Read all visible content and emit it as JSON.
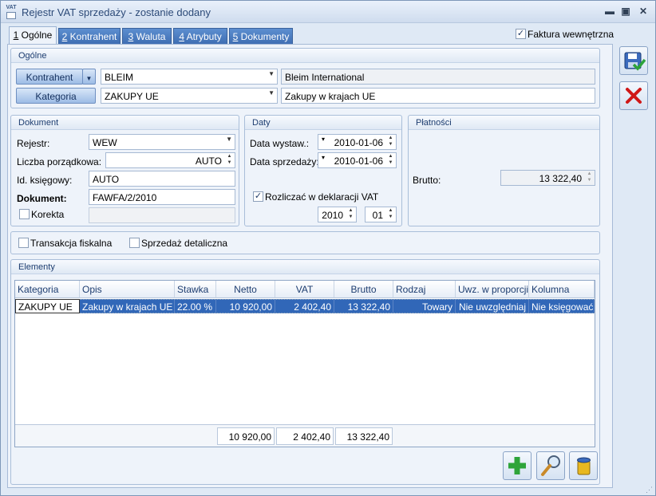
{
  "window": {
    "title": "Rejestr VAT sprzedaży - zostanie dodany",
    "icon_text": "VAT"
  },
  "tabs": [
    {
      "num": "1",
      "label": "Ogólne"
    },
    {
      "num": "2",
      "label": "Kontrahent"
    },
    {
      "num": "3",
      "label": "Waluta"
    },
    {
      "num": "4",
      "label": "Atrybuty"
    },
    {
      "num": "5",
      "label": "Dokumenty"
    }
  ],
  "faktura_wewnetrzna": {
    "label": "Faktura wewnętrzna",
    "checked": true
  },
  "ogolne": {
    "header": "Ogólne",
    "kontrahent_btn": "Kontrahent",
    "kontrahent_code": "BLEIM",
    "kontrahent_name": "Bleim International",
    "kategoria_btn": "Kategoria",
    "kategoria_code": "ZAKUPY UE",
    "kategoria_desc": "Zakupy w krajach UE"
  },
  "dokument": {
    "header": "Dokument",
    "rejestr_label": "Rejestr:",
    "rejestr_value": "WEW",
    "lp_label": "Liczba porządkowa:",
    "lp_value": "AUTO",
    "idk_label": "Id. księgowy:",
    "idk_value": "AUTO",
    "dok_label": "Dokument:",
    "dok_value": "FAWFA/2/2010",
    "korekta_label": "Korekta"
  },
  "daty": {
    "header": "Daty",
    "wystaw_label": "Data wystaw.:",
    "wystaw_value": "2010-01-06",
    "sprzed_label": "Data sprzedaży:",
    "sprzed_value": "2010-01-06",
    "rozliczac_label": "Rozliczać w deklaracji VAT",
    "year": "2010",
    "month": "01"
  },
  "platnosci": {
    "header": "Płatności",
    "brutto_label": "Brutto:",
    "brutto_value": "13 322,40"
  },
  "flags": {
    "fiskalna": "Transakcja fiskalna",
    "detaliczna": "Sprzedaż detaliczna"
  },
  "elementy": {
    "header": "Elementy",
    "columns": [
      "Kategoria",
      "Opis",
      "Stawka",
      "Netto",
      "VAT",
      "Brutto",
      "Rodzaj",
      "Uwz. w proporcji",
      "Kolumna"
    ],
    "rows": [
      [
        "ZAKUPY UE",
        "Zakupy w krajach UE",
        "22.00 %",
        "10 920,00",
        "2 402,40",
        "13 322,40",
        "Towary",
        "Nie uwzględniaj",
        "Nie księgować"
      ]
    ],
    "totals": {
      "netto": "10 920,00",
      "vat": "2 402,40",
      "brutto": "13 322,40"
    }
  },
  "colors": {
    "accent": "#3167b8",
    "tab_blue": "#4a7bc0",
    "cancel_red": "#d01818",
    "save_blue": "#2a5fb0"
  }
}
